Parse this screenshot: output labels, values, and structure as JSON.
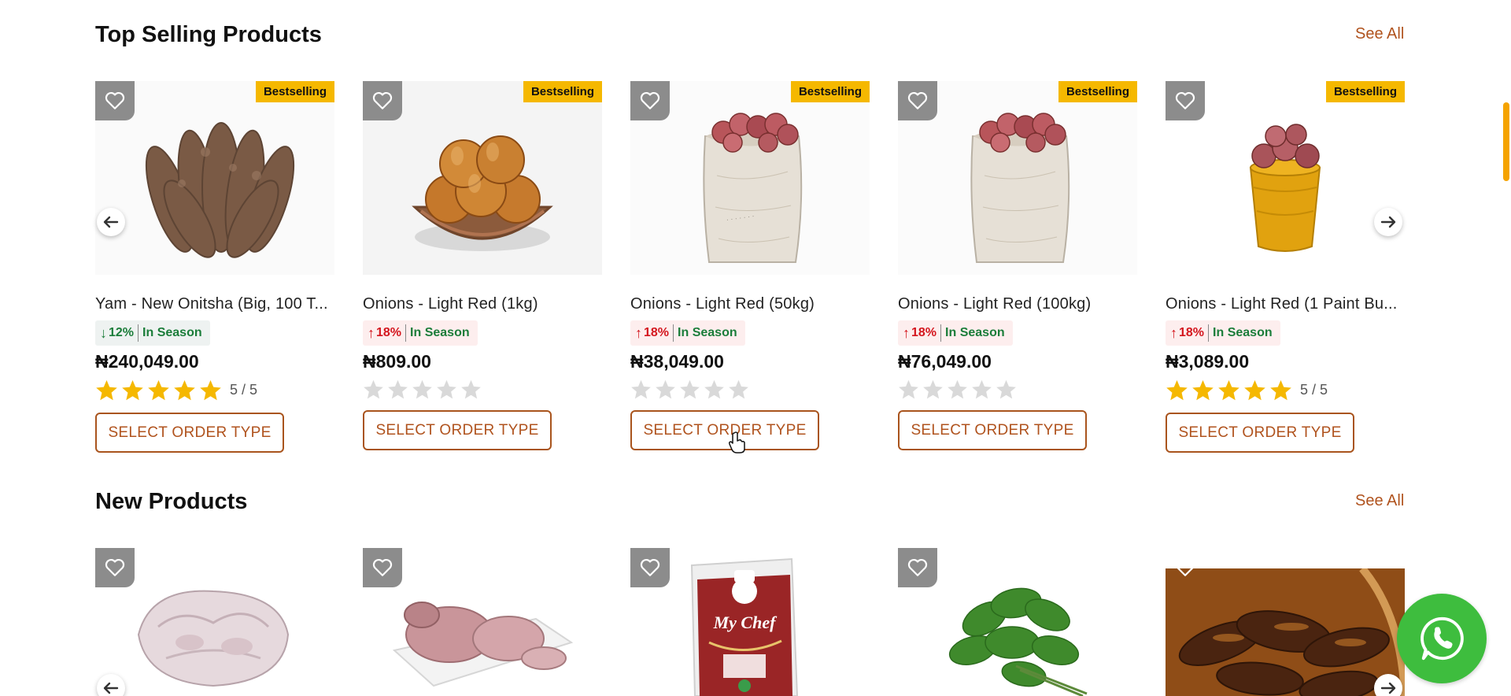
{
  "top_selling": {
    "title": "Top Selling Products",
    "see_all": "See All",
    "products": [
      {
        "name": "Yam - New Onitsha (Big, 100 T...",
        "trend": "down",
        "change": "12%",
        "season": "In Season",
        "price": "₦240,049.00",
        "rating": 5,
        "rating_text": "5 / 5",
        "badge": "Bestselling",
        "button": "SELECT ORDER TYPE",
        "image": "yam-bundle"
      },
      {
        "name": "Onions - Light Red (1kg)",
        "trend": "up",
        "change": "18%",
        "season": "In Season",
        "price": "₦809.00",
        "rating": 0,
        "rating_text": "",
        "badge": "Bestselling",
        "button": "SELECT ORDER TYPE",
        "image": "onions-in-basket"
      },
      {
        "name": "Onions - Light Red (50kg)",
        "trend": "up",
        "change": "18%",
        "season": "In Season",
        "price": "₦38,049.00",
        "rating": 0,
        "rating_text": "",
        "badge": "Bestselling",
        "button": "SELECT ORDER TYPE",
        "image": "onion-sack"
      },
      {
        "name": "Onions - Light Red (100kg)",
        "trend": "up",
        "change": "18%",
        "season": "In Season",
        "price": "₦76,049.00",
        "rating": 0,
        "rating_text": "",
        "badge": "Bestselling",
        "button": "SELECT ORDER TYPE",
        "image": "onion-sack"
      },
      {
        "name": "Onions - Light Red (1 Paint Bu...",
        "trend": "up",
        "change": "18%",
        "season": "In Season",
        "price": "₦3,089.00",
        "rating": 5,
        "rating_text": "5 / 5",
        "badge": "Bestselling",
        "button": "SELECT ORDER TYPE",
        "image": "onion-bucket"
      }
    ]
  },
  "new_products": {
    "title": "New Products",
    "see_all": "See All",
    "products": [
      {
        "image": "raw-chicken"
      },
      {
        "image": "chicken-tray"
      },
      {
        "image": "rice-bag",
        "bag_brand": "My Chef"
      },
      {
        "image": "green-vegetable"
      },
      {
        "image": "smoked-fish-basket"
      }
    ]
  },
  "icons": {
    "favorite": "heart-outline-icon",
    "prev": "arrow-left-icon",
    "next": "arrow-right-icon",
    "chat": "whatsapp-icon",
    "star": "star-icon"
  },
  "colors": {
    "accent": "#b0531e",
    "badge": "#f5b800",
    "star_filled": "#f5b800",
    "star_empty": "#d9d9d9",
    "trend_down": "#1b7d3a",
    "trend_up": "#d4161e",
    "whatsapp": "#3ebd3e",
    "scrollbar": "#f5a300"
  }
}
